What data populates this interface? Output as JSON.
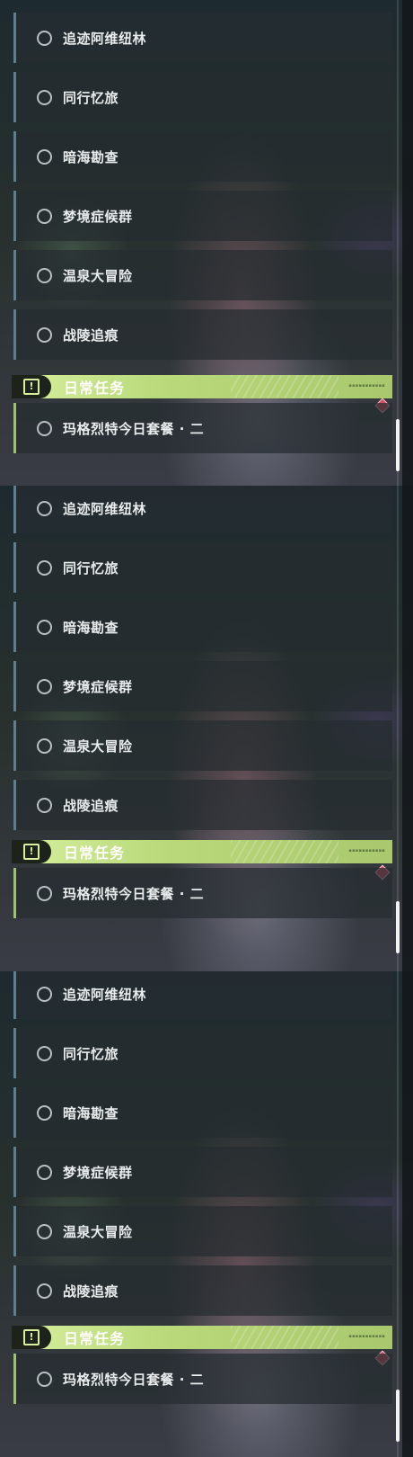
{
  "panels": [
    {
      "quests": [
        "追迹阿维纽林",
        "同行忆旅",
        "暗海勘查",
        "梦境症候群",
        "温泉大冒险",
        "战陵追痕"
      ],
      "category": {
        "icon": "exclamation-icon",
        "title": "日常任务"
      },
      "daily_quests": [
        "玛格烈特今日套餐 · 二"
      ]
    },
    {
      "quests": [
        "追迹阿维纽林",
        "同行忆旅",
        "暗海勘查",
        "梦境症候群",
        "温泉大冒险",
        "战陵追痕"
      ],
      "category": {
        "icon": "exclamation-icon",
        "title": "日常任务"
      },
      "daily_quests": [
        "玛格烈特今日套餐 · 二"
      ]
    },
    {
      "quests": [
        "追迹阿维纽林",
        "同行忆旅",
        "暗海勘查",
        "梦境症候群",
        "温泉大冒险",
        "战陵追痕"
      ],
      "category": {
        "icon": "exclamation-icon",
        "title": "日常任务"
      },
      "daily_quests": [
        "玛格烈特今日套餐 · 二"
      ]
    }
  ],
  "colors": {
    "accent_green": "#b9d97a",
    "new_marker": "#d44e66",
    "quest_bar": "#5d7f8e"
  }
}
